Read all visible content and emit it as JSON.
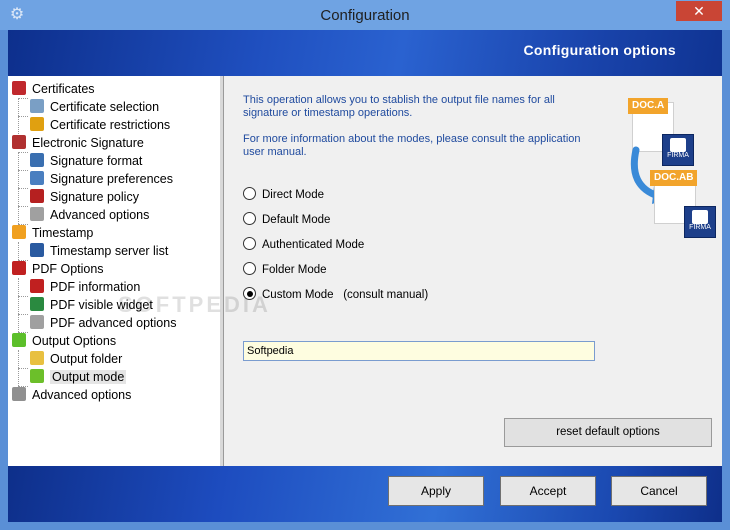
{
  "window": {
    "title": "Configuration",
    "close_glyph": "✕",
    "icon": "gear-icon"
  },
  "banner": {
    "title": "Configuration options"
  },
  "tree": [
    {
      "label": "Certificates",
      "level": 0,
      "icon": "seal-icon",
      "color": "#c0282d"
    },
    {
      "label": "Certificate selection",
      "level": 1,
      "icon": "magnifier-icon",
      "color": "#7a9fc5"
    },
    {
      "label": "Certificate restrictions",
      "level": 1,
      "icon": "lock-icon",
      "color": "#e0a010"
    },
    {
      "label": "Electronic Signature",
      "level": 0,
      "icon": "pen-icon",
      "color": "#b03030"
    },
    {
      "label": "Signature format",
      "level": 1,
      "icon": "document-icon",
      "color": "#3a6fb0"
    },
    {
      "label": "Signature preferences",
      "level": 1,
      "icon": "clipboard-icon",
      "color": "#4a7fc0"
    },
    {
      "label": "Signature policy",
      "level": 1,
      "icon": "policy-icon",
      "color": "#b52020"
    },
    {
      "label": "Advanced options",
      "level": 1,
      "icon": "gears-icon",
      "color": "#a0a0a0"
    },
    {
      "label": "Timestamp",
      "level": 0,
      "icon": "clock-icon",
      "color": "#f0a020"
    },
    {
      "label": "Timestamp server list",
      "level": 1,
      "icon": "server-list-icon",
      "color": "#2a5aa0"
    },
    {
      "label": "PDF Options",
      "level": 0,
      "icon": "pdf-icon",
      "color": "#c02020"
    },
    {
      "label": "PDF information",
      "level": 1,
      "icon": "pdf-file-icon",
      "color": "#c02020"
    },
    {
      "label": "PDF visible widget",
      "level": 1,
      "icon": "pdf-widget-icon",
      "color": "#2a8a40"
    },
    {
      "label": "PDF advanced options",
      "level": 1,
      "icon": "gears-icon",
      "color": "#a0a0a0"
    },
    {
      "label": "Output Options",
      "level": 0,
      "icon": "up-arrow-icon",
      "color": "#5cbf2a"
    },
    {
      "label": "Output folder",
      "level": 1,
      "icon": "folder-icon",
      "color": "#e8c040"
    },
    {
      "label": "Output mode",
      "level": 1,
      "icon": "mode-icon",
      "color": "#6cbf2a",
      "selected": true
    },
    {
      "label": "Advanced options",
      "level": 0,
      "icon": "gears-icon",
      "color": "#909090"
    }
  ],
  "content": {
    "info_1": "This operation allows you to stablish the output file names for all signature or timestamp operations.",
    "info_2": "For more information about the modes, please consult the application user manual.",
    "modes": [
      {
        "label": "Direct Mode",
        "selected": false
      },
      {
        "label": "Default Mode",
        "selected": false
      },
      {
        "label": "Authenticated Mode",
        "selected": false
      },
      {
        "label": "Folder Mode",
        "selected": false
      },
      {
        "label": "Custom Mode",
        "selected": true,
        "note": "(consult manual)"
      }
    ],
    "custom_value": "Softpedia",
    "reset_label": "reset default options",
    "doc_a": "DOC.A",
    "doc_ab": "DOC.AB",
    "firma": "FIRMA",
    "watermark": "SOFTPEDIA"
  },
  "footer": {
    "apply": "Apply",
    "accept": "Accept",
    "cancel": "Cancel"
  }
}
